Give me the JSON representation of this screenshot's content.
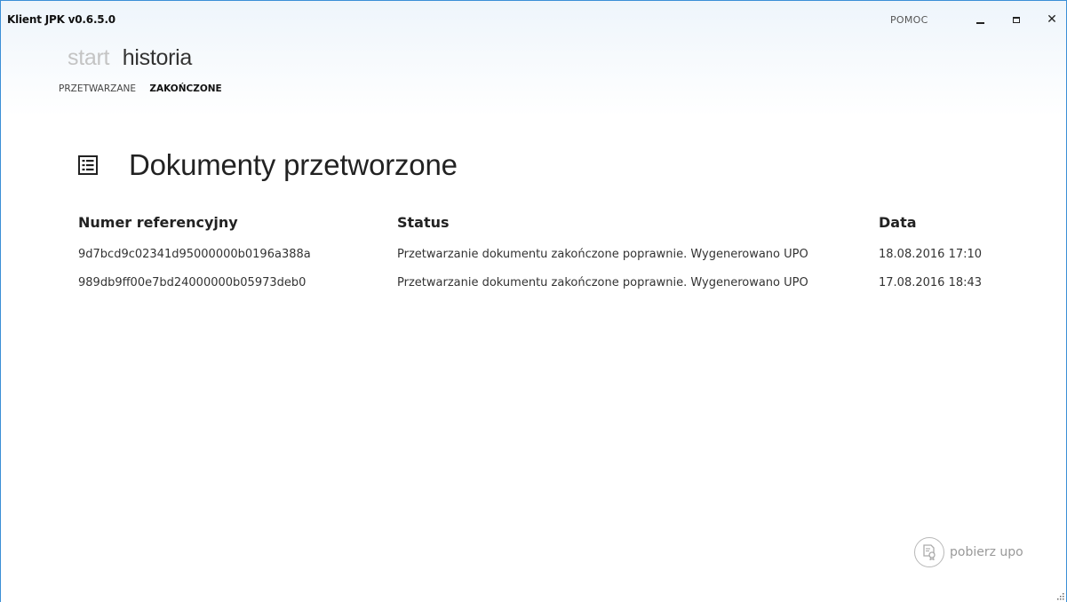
{
  "window": {
    "title": "Klient JPK v0.6.5.0",
    "help_label": "POMOC",
    "controls": {
      "minimize_icon": "minimize-icon",
      "maximize_icon": "maximize-icon",
      "close_icon": "close-icon",
      "close_glyph": "✕"
    }
  },
  "nav": {
    "items": [
      {
        "label": "start",
        "active": false
      },
      {
        "label": "historia",
        "active": true
      }
    ]
  },
  "subnav": {
    "items": [
      {
        "label": "PRZETWARZANE",
        "active": false
      },
      {
        "label": "ZAKOŃCZONE",
        "active": true
      }
    ]
  },
  "main": {
    "icon": "document-list-icon",
    "title": "Dokumenty przetworzone",
    "table": {
      "headers": {
        "ref": "Numer referencyjny",
        "status": "Status",
        "date": "Data"
      },
      "rows": [
        {
          "ref": "9d7bcd9c02341d95000000b0196a388a",
          "status": "Przetwarzanie dokumentu zakończone poprawnie. Wygenerowano UPO",
          "date": "18.08.2016 17:10"
        },
        {
          "ref": "989db9ff00e7bd24000000b05973deb0",
          "status": "Przetwarzanie dokumentu zakończone poprawnie. Wygenerowano UPO",
          "date": "17.08.2016 18:43"
        }
      ]
    }
  },
  "actions": {
    "download_upo_label": "pobierz upo",
    "download_upo_icon": "certificate-icon"
  },
  "colors": {
    "accent_border": "#3b8fd6",
    "inactive_nav": "#c4c4c4",
    "disabled_action": "#999999"
  }
}
